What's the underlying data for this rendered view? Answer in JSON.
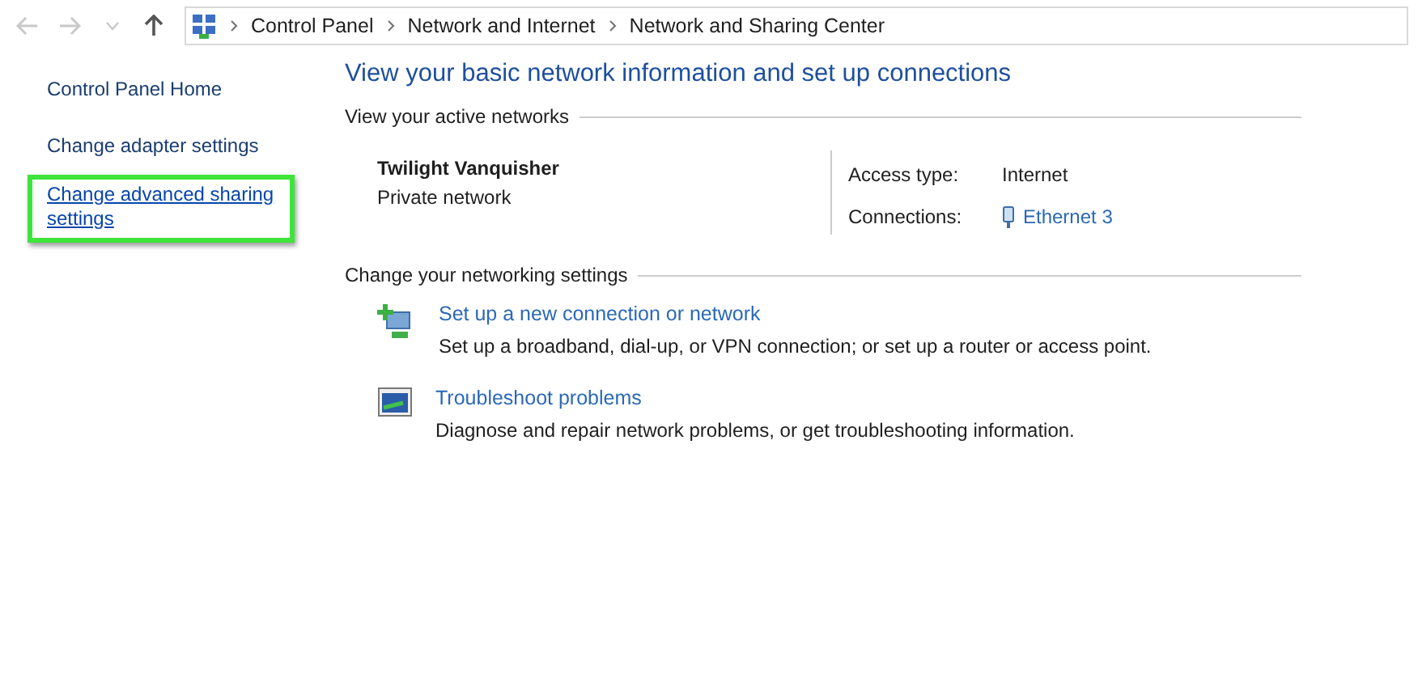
{
  "nav": [
    {
      "kind": "back",
      "disabled": true
    },
    {
      "kind": "forward",
      "disabled": true
    },
    {
      "kind": "recent",
      "disabled": true
    },
    {
      "kind": "up",
      "disabled": false
    }
  ],
  "breadcrumb": [
    "Control Panel",
    "Network and Internet",
    "Network and Sharing Center"
  ],
  "sidebar": {
    "items": [
      {
        "label": "Control Panel Home",
        "highlighted": false
      },
      {
        "label": "Change adapter settings",
        "highlighted": false
      },
      {
        "label": "Change advanced sharing settings",
        "highlighted": true
      }
    ]
  },
  "title": "View your basic network information and set up connections",
  "active_networks": {
    "heading": "View your active networks",
    "name": "Twilight Vanquisher",
    "category": "Private network",
    "details": [
      {
        "label": "Access type:",
        "value": "Internet",
        "kind": "text"
      },
      {
        "label": "Connections:",
        "value": "Ethernet 3",
        "kind": "link"
      }
    ]
  },
  "settings": {
    "heading": "Change your networking settings",
    "tasks": [
      {
        "kind": "connection",
        "title": "Set up a new connection or network",
        "description": "Set up a broadband, dial-up, or VPN connection; or set up a router or access point."
      },
      {
        "kind": "troubleshoot",
        "title": "Troubleshoot problems",
        "description": "Diagnose and repair network problems, or get troubleshooting information."
      }
    ]
  }
}
